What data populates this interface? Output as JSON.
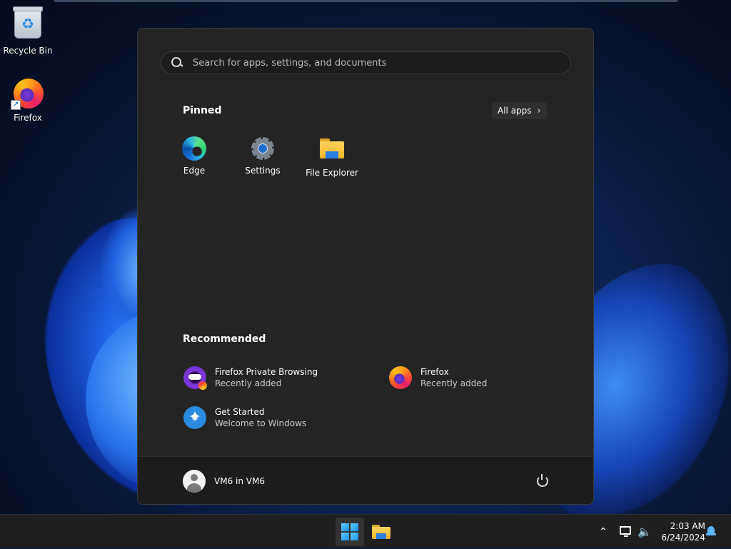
{
  "desktop": {
    "icons": [
      {
        "label": "Recycle Bin",
        "icon": "recycle-bin-icon"
      },
      {
        "label": "Firefox",
        "icon": "firefox-icon"
      }
    ]
  },
  "start_menu": {
    "search": {
      "placeholder": "Search for apps, settings, and documents",
      "value": ""
    },
    "pinned": {
      "title": "Pinned",
      "all_apps_label": "All apps",
      "apps": [
        {
          "label": "Edge",
          "icon": "edge-icon"
        },
        {
          "label": "Settings",
          "icon": "settings-icon"
        },
        {
          "label": "File Explorer",
          "icon": "file-explorer-icon"
        }
      ]
    },
    "recommended": {
      "title": "Recommended",
      "items": [
        {
          "name": "Firefox Private Browsing",
          "sub": "Recently added",
          "icon": "firefox-private-icon"
        },
        {
          "name": "Firefox",
          "sub": "Recently added",
          "icon": "firefox-icon"
        },
        {
          "name": "Get Started",
          "sub": "Welcome to Windows",
          "icon": "get-started-icon"
        }
      ]
    },
    "footer": {
      "user_name": "VM6 in VM6",
      "power_icon": "power-icon"
    }
  },
  "taskbar": {
    "apps": [
      {
        "name": "Start",
        "icon": "windows-logo-icon",
        "active": true
      },
      {
        "name": "File Explorer",
        "icon": "file-explorer-icon",
        "active": false
      }
    ],
    "tray": {
      "chevron_icon": "chevron-up-icon",
      "network_icon": "network-icon",
      "volume_icon": "volume-icon",
      "time": "2:03 AM",
      "date": "6/24/2024",
      "notification_icon": "bell-icon"
    }
  },
  "colors": {
    "start_bg": "#242424",
    "footer_bg": "#1c1c1c",
    "taskbar_bg": "#1f1f1f",
    "accent": "#1b8fe8"
  }
}
